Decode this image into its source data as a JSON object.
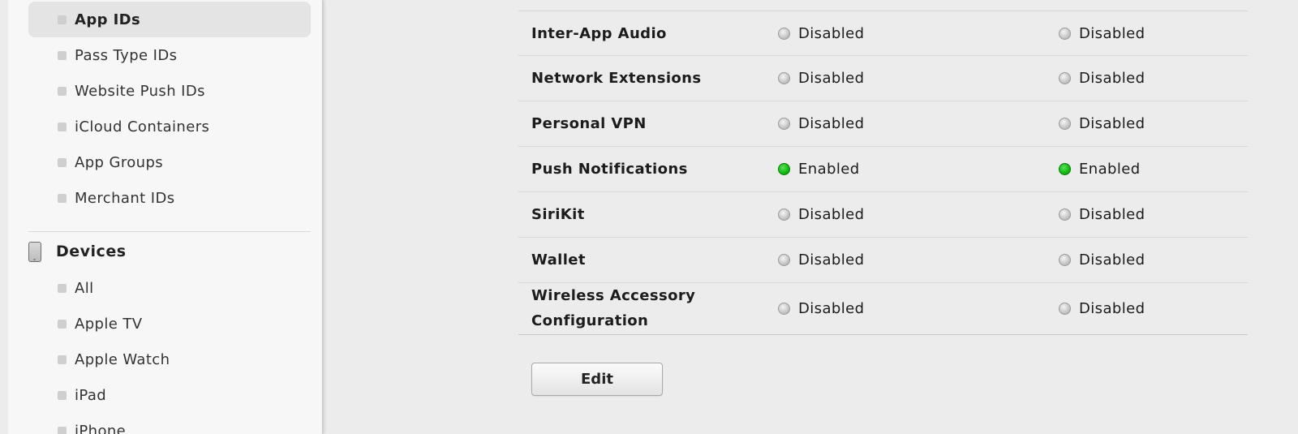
{
  "sidebar": {
    "items": [
      {
        "label": "App IDs",
        "selected": true
      },
      {
        "label": "Pass Type IDs"
      },
      {
        "label": "Website Push IDs"
      },
      {
        "label": "iCloud Containers"
      },
      {
        "label": "App Groups"
      },
      {
        "label": "Merchant IDs"
      }
    ],
    "devices_section": {
      "label": "Devices",
      "icon": "ipad-device-icon",
      "items": [
        {
          "label": "All"
        },
        {
          "label": "Apple TV"
        },
        {
          "label": "Apple Watch"
        },
        {
          "label": "iPad"
        },
        {
          "label": "iPhone"
        }
      ]
    }
  },
  "capabilities": [
    {
      "name": "Inter-App Audio",
      "development": "Disabled",
      "distribution": "Disabled"
    },
    {
      "name": "Network Extensions",
      "development": "Disabled",
      "distribution": "Disabled"
    },
    {
      "name": "Personal VPN",
      "development": "Disabled",
      "distribution": "Disabled"
    },
    {
      "name": "Push Notifications",
      "development": "Enabled",
      "distribution": "Enabled"
    },
    {
      "name": "SiriKit",
      "development": "Disabled",
      "distribution": "Disabled"
    },
    {
      "name": "Wallet",
      "development": "Disabled",
      "distribution": "Disabled"
    },
    {
      "name": "Wireless Accessory Configuration",
      "development": "Disabled",
      "distribution": "Disabled"
    }
  ],
  "actions": {
    "edit_label": "Edit"
  },
  "colors": {
    "enabled": "#0fb80f",
    "disabled": "#bdbdbd"
  }
}
